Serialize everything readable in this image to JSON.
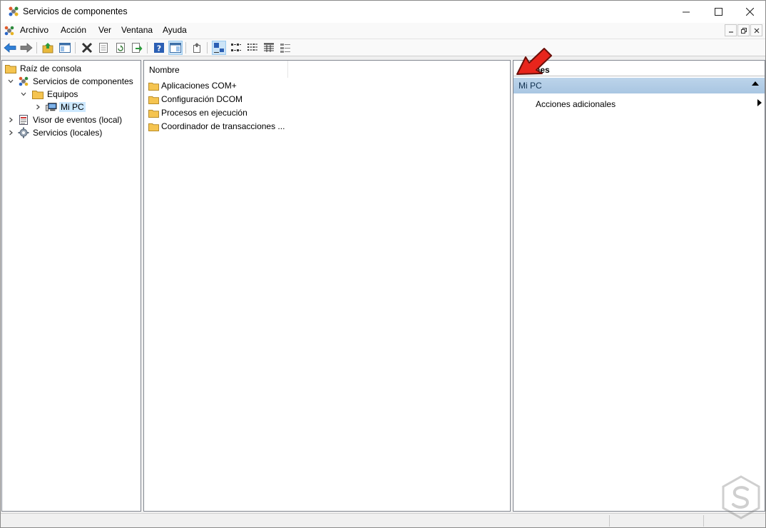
{
  "window": {
    "title": "Servicios de componentes",
    "controls": {
      "minimize": "—",
      "maximize": "☐",
      "close": "✕"
    }
  },
  "menu": [
    "Archivo",
    "Acción",
    "Ver",
    "Ventana",
    "Ayuda"
  ],
  "tree": {
    "root": "Raíz de consola",
    "items": [
      {
        "label": "Servicios de componentes",
        "icon": "component-services-icon"
      },
      {
        "label": "Equipos",
        "icon": "folder-icon"
      },
      {
        "label": "Mi PC",
        "icon": "computer-icon",
        "selected": true
      },
      {
        "label": "Visor de eventos (local)",
        "icon": "event-viewer-icon"
      },
      {
        "label": "Servicios (locales)",
        "icon": "services-icon"
      }
    ]
  },
  "list": {
    "column": "Nombre",
    "items": [
      "Aplicaciones COM+",
      "Configuración DCOM",
      "Procesos en ejecución",
      "Coordinador de transacciones ..."
    ]
  },
  "actions": {
    "header": "nes",
    "section": "Mi PC",
    "item": "Acciones adicionales"
  },
  "colors": {
    "section_bg": "#b4cee7",
    "selection": "#cce8ff",
    "folder": "#f5c450",
    "arrow": "#e8251c"
  }
}
